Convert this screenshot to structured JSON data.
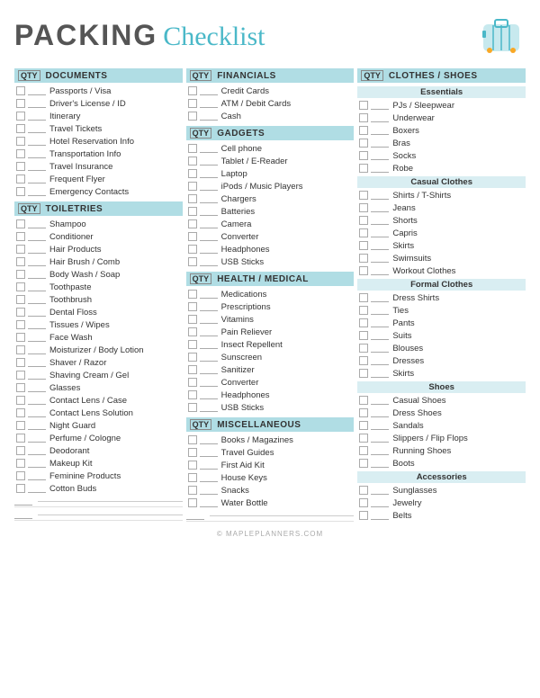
{
  "header": {
    "packing": "PACKING",
    "checklist": "Checklist",
    "icon_label": "luggage-bag-icon"
  },
  "columns": {
    "col1": {
      "documents": {
        "header": "DOCUMENTS",
        "qty": "QTY",
        "items": [
          "Passports / Visa",
          "Driver's License / ID",
          "Itinerary",
          "Travel Tickets",
          "Hotel Reservation Info",
          "Transportation Info",
          "Travel Insurance",
          "Frequent Flyer",
          "Emergency Contacts"
        ]
      },
      "toiletries": {
        "header": "TOILETRIES",
        "qty": "QTY",
        "items": [
          "Shampoo",
          "Conditioner",
          "Hair Products",
          "Hair Brush / Comb",
          "Body Wash / Soap",
          "Toothpaste",
          "Toothbrush",
          "Dental Floss",
          "Tissues / Wipes",
          "Face Wash",
          "Moisturizer / Body Lotion",
          "Shaver / Razor",
          "Shaving Cream / Gel",
          "Glasses",
          "Contact Lens / Case",
          "Contact Lens Solution",
          "Night Guard",
          "Perfume / Cologne",
          "Deodorant",
          "Makeup Kit",
          "Feminine Products",
          "Cotton Buds"
        ]
      }
    },
    "col2": {
      "financials": {
        "header": "FINANCIALS",
        "qty": "QTY",
        "items": [
          "Credit Cards",
          "ATM / Debit Cards",
          "Cash"
        ]
      },
      "gadgets": {
        "header": "GADGETS",
        "qty": "QTY",
        "items": [
          "Cell phone",
          "Tablet / E-Reader",
          "Laptop",
          "iPods / Music Players",
          "Chargers",
          "Batteries",
          "Camera",
          "Converter",
          "Headphones",
          "USB Sticks"
        ]
      },
      "health": {
        "header": "HEALTH / MEDICAL",
        "qty": "QTY",
        "items": [
          "Medications",
          "Prescriptions",
          "Vitamins",
          "Pain Reliever",
          "Insect Repellent",
          "Sunscreen",
          "Sanitizer",
          "Converter",
          "Headphones",
          "USB Sticks"
        ]
      },
      "miscellaneous": {
        "header": "MISCELLANEOUS",
        "qty": "QTY",
        "items": [
          "Books / Magazines",
          "Travel Guides",
          "First Aid Kit",
          "House Keys",
          "Snacks",
          "Water Bottle"
        ]
      }
    },
    "col3": {
      "clothes_shoes": {
        "header": "CLOTHES / SHOES",
        "qty": "QTY",
        "essentials": {
          "label": "Essentials",
          "items": [
            "PJs / Sleepwear",
            "Underwear",
            "Boxers",
            "Bras",
            "Socks",
            "Robe"
          ]
        },
        "casual": {
          "label": "Casual Clothes",
          "items": [
            "Shirts / T-Shirts",
            "Jeans",
            "Shorts",
            "Capris",
            "Skirts",
            "Swimsuits",
            "Workout Clothes"
          ]
        },
        "formal": {
          "label": "Formal Clothes",
          "items": [
            "Dress Shirts",
            "Ties",
            "Pants",
            "Suits",
            "Blouses",
            "Dresses",
            "Skirts"
          ]
        },
        "shoes": {
          "label": "Shoes",
          "items": [
            "Casual Shoes",
            "Dress Shoes",
            "Sandals",
            "Slippers / Flip Flops",
            "Running Shoes",
            "Boots"
          ]
        },
        "accessories": {
          "label": "Accessories",
          "items": [
            "Sunglasses",
            "Jewelry",
            "Belts"
          ]
        }
      }
    }
  },
  "footer": "© MAPLEPLANNERS.COM"
}
